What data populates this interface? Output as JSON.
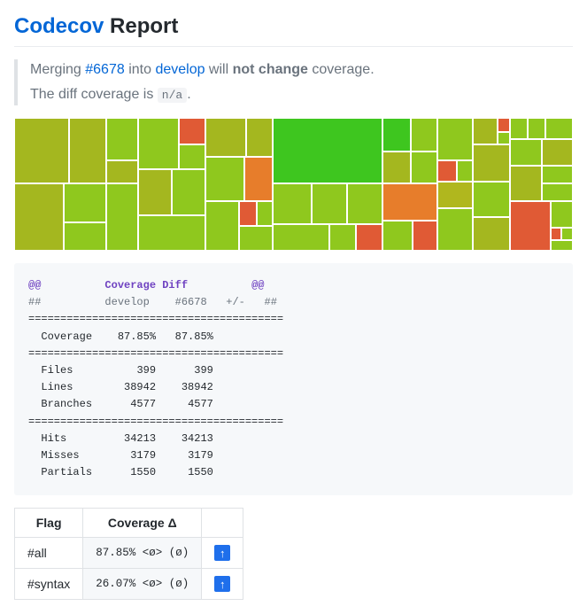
{
  "header": {
    "brand": "Codecov",
    "rest": " Report"
  },
  "quote": {
    "line1_pre": "Merging ",
    "pr_link": "#6678",
    "line1_mid": " into ",
    "branch_link": "develop",
    "line1_mid2": " will ",
    "bold": "not change",
    "line1_post": " coverage.",
    "line2_pre": "The diff coverage is ",
    "diff_cov": "n/a",
    "line2_post": "."
  },
  "diff": {
    "at": "@@",
    "title": "Coverage Diff",
    "hash": "##",
    "col_base": "develop",
    "col_head": "#6678",
    "col_delta": "+/-",
    "sep": "========================================",
    "rows": {
      "coverage": {
        "label": "Coverage",
        "base": "87.85%",
        "head": "87.85%"
      },
      "files": {
        "label": "Files",
        "base": "399",
        "head": "399"
      },
      "lines": {
        "label": "Lines",
        "base": "38942",
        "head": "38942"
      },
      "branches": {
        "label": "Branches",
        "base": "4577",
        "head": "4577"
      },
      "hits": {
        "label": "Hits",
        "base": "34213",
        "head": "34213"
      },
      "misses": {
        "label": "Misses",
        "base": "3179",
        "head": "3179"
      },
      "partials": {
        "label": "Partials",
        "base": "1550",
        "head": "1550"
      }
    }
  },
  "flags": {
    "head_flag": "Flag",
    "head_cov": "Coverage Δ",
    "rows": [
      {
        "name": "#all",
        "cov": "87.85% <ø> (ø)",
        "carry": "↑"
      },
      {
        "name": "#syntax",
        "cov": "26.07% <ø> (ø)",
        "carry": "↑"
      }
    ]
  }
}
